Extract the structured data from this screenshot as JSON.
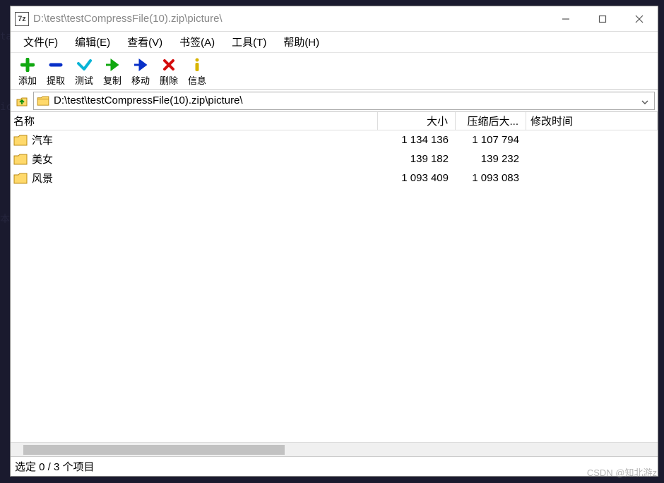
{
  "window": {
    "title": "D:\\test\\testCompressFile(10).zip\\picture\\",
    "icon_label": "7z"
  },
  "menus": [
    {
      "label": "文件(F)"
    },
    {
      "label": "编辑(E)"
    },
    {
      "label": "查看(V)"
    },
    {
      "label": "书签(A)"
    },
    {
      "label": "工具(T)"
    },
    {
      "label": "帮助(H)"
    }
  ],
  "toolbar": {
    "add": "添加",
    "extract": "提取",
    "test": "测试",
    "copy": "复制",
    "move": "移动",
    "delete": "删除",
    "info": "信息"
  },
  "path": {
    "value": "D:\\test\\testCompressFile(10).zip\\picture\\"
  },
  "columns": {
    "name": "名称",
    "size": "大小",
    "packed": "压缩后大...",
    "modified": "修改时间"
  },
  "rows": [
    {
      "name": "汽车",
      "size": "1 134 136",
      "packed": "1 107 794",
      "modified": ""
    },
    {
      "name": "美女",
      "size": "139 182",
      "packed": "139 232",
      "modified": ""
    },
    {
      "name": "风景",
      "size": "1 093 409",
      "packed": "1 093 083",
      "modified": ""
    }
  ],
  "status": {
    "text": "选定 0 / 3 个项目"
  },
  "watermark": "CSDN @知北游z"
}
